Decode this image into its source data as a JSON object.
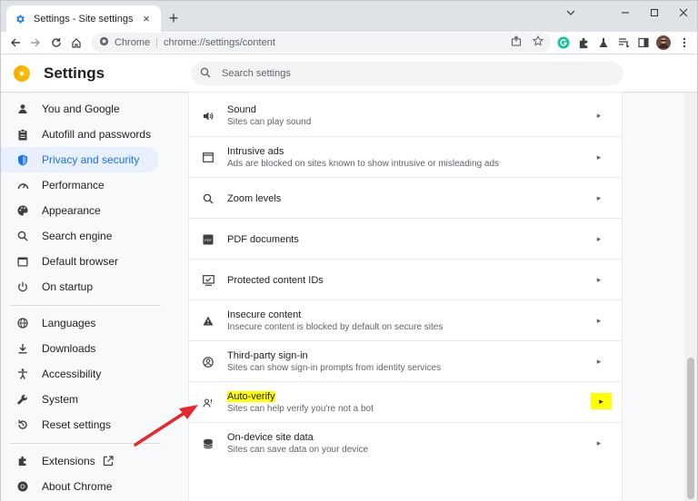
{
  "tab": {
    "title": "Settings - Site settings",
    "close": "×"
  },
  "toolbar": {
    "new_tab": "+",
    "site_label": "Chrome",
    "url": "chrome://settings/content"
  },
  "header": {
    "title": "Settings",
    "search_placeholder": "Search settings"
  },
  "sidebar": {
    "items": [
      {
        "label": "You and Google",
        "icon": "person-icon"
      },
      {
        "label": "Autofill and passwords",
        "icon": "clipboard-icon"
      },
      {
        "label": "Privacy and security",
        "icon": "shield-icon",
        "active": true
      },
      {
        "label": "Performance",
        "icon": "speedometer-icon"
      },
      {
        "label": "Appearance",
        "icon": "palette-icon"
      },
      {
        "label": "Search engine",
        "icon": "search-icon"
      },
      {
        "label": "Default browser",
        "icon": "browser-icon"
      },
      {
        "label": "On startup",
        "icon": "power-icon"
      },
      {
        "label": "Languages",
        "icon": "globe-icon"
      },
      {
        "label": "Downloads",
        "icon": "download-icon"
      },
      {
        "label": "Accessibility",
        "icon": "accessibility-icon"
      },
      {
        "label": "System",
        "icon": "wrench-icon"
      },
      {
        "label": "Reset settings",
        "icon": "reset-icon"
      },
      {
        "label": "Extensions",
        "icon": "puzzle-icon"
      },
      {
        "label": "About Chrome",
        "icon": "chrome-icon"
      }
    ]
  },
  "content": {
    "rows": [
      {
        "title": "Sound",
        "sub": "Sites can play sound",
        "icon": "speaker-icon"
      },
      {
        "title": "Intrusive ads",
        "sub": "Ads are blocked on sites known to show intrusive or misleading ads",
        "icon": "ad-window-icon"
      },
      {
        "title": "Zoom levels",
        "sub": "",
        "icon": "zoom-icon"
      },
      {
        "title": "PDF documents",
        "sub": "",
        "icon": "pdf-icon"
      },
      {
        "title": "Protected content IDs",
        "sub": "",
        "icon": "protected-content-icon"
      },
      {
        "title": "Insecure content",
        "sub": "Insecure content is blocked by default on secure sites",
        "icon": "warning-icon"
      },
      {
        "title": "Third-party sign-in",
        "sub": "Sites can show sign-in prompts from identity services",
        "icon": "account-circle-icon"
      },
      {
        "title": "Auto-verify",
        "sub": "Sites can help verify you're not a bot",
        "icon": "person-check-icon",
        "highlighted": true
      },
      {
        "title": "On-device site data",
        "sub": "Sites can save data on your device",
        "icon": "database-icon"
      }
    ]
  },
  "colors": {
    "accent": "#1a73e8",
    "active_bg": "#e8f0fe",
    "highlight": "#ffff00",
    "annotation_arrow": "#e8262d"
  }
}
